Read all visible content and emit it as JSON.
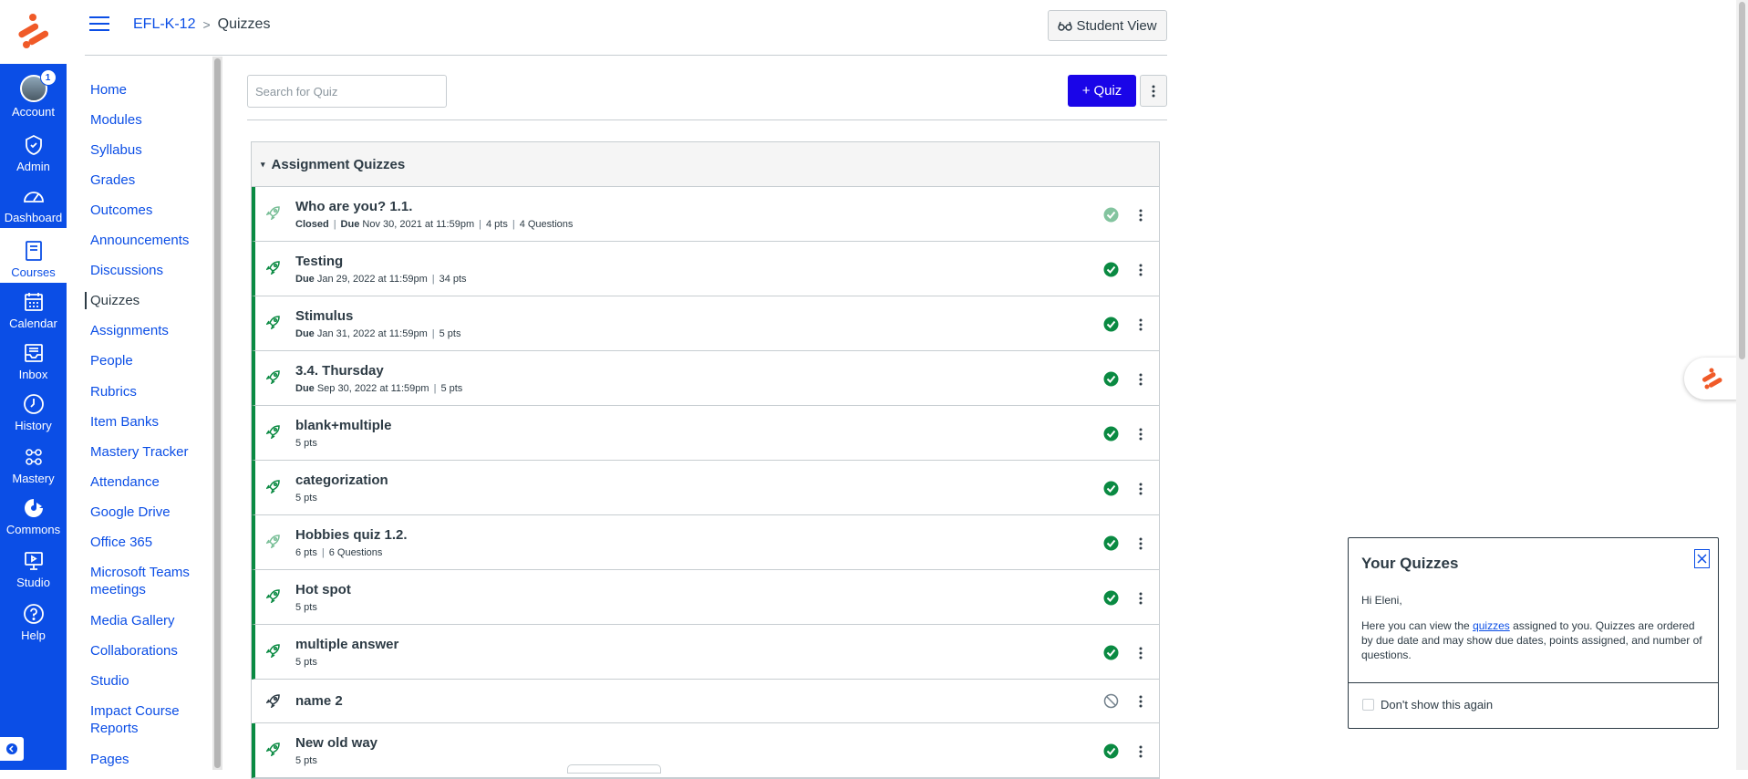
{
  "global_nav": {
    "items": [
      {
        "label": "Account",
        "icon": "avatar",
        "badge": "1"
      },
      {
        "label": "Admin",
        "icon": "shield-icon"
      },
      {
        "label": "Dashboard",
        "icon": "dashboard-icon"
      },
      {
        "label": "Courses",
        "icon": "book-icon",
        "active": true
      },
      {
        "label": "Calendar",
        "icon": "calendar-icon"
      },
      {
        "label": "Inbox",
        "icon": "inbox-icon"
      },
      {
        "label": "History",
        "icon": "clock-icon"
      },
      {
        "label": "Mastery",
        "icon": "mastery-icon"
      },
      {
        "label": "Commons",
        "icon": "commons-icon"
      },
      {
        "label": "Studio",
        "icon": "studio-icon"
      },
      {
        "label": "Help",
        "icon": "help-icon"
      }
    ]
  },
  "header": {
    "course": "EFL-K-12",
    "separator": ">",
    "page": "Quizzes",
    "student_view": "Student View"
  },
  "course_nav": [
    "Home",
    "Modules",
    "Syllabus",
    "Grades",
    "Outcomes",
    "Announcements",
    "Discussions",
    "Quizzes",
    "Assignments",
    "People",
    "Rubrics",
    "Item Banks",
    "Mastery Tracker",
    "Attendance",
    "Google Drive",
    "Office 365",
    "Microsoft Teams meetings",
    "Media Gallery",
    "Collaborations",
    "Studio",
    "Impact Course Reports",
    "Pages"
  ],
  "toolbar": {
    "search_placeholder": "Search for Quiz",
    "add_quiz_label": "Quiz",
    "add_quiz_plus": "+"
  },
  "quiz_group": {
    "title": "Assignment Quizzes",
    "caret": "▾",
    "quizzes": [
      {
        "title": "Who are you? 1.1.",
        "closed": "Closed",
        "due_label": "Due",
        "due": "Nov 30, 2021 at 11:59pm",
        "pts": "4 pts",
        "questions": "4 Questions",
        "published": true,
        "status": "published-faded"
      },
      {
        "title": "Testing",
        "due_label": "Due",
        "due": "Jan 29, 2022 at 11:59pm",
        "pts": "34 pts",
        "published": true,
        "status": "published"
      },
      {
        "title": "Stimulus",
        "due_label": "Due",
        "due": "Jan 31, 2022 at 11:59pm",
        "pts": "5 pts",
        "published": true,
        "status": "published"
      },
      {
        "title": "3.4. Thursday",
        "due_label": "Due",
        "due": "Sep 30, 2022 at 11:59pm",
        "pts": "5 pts",
        "published": true,
        "status": "published"
      },
      {
        "title": "blank+multiple",
        "pts": "5 pts",
        "published": true,
        "status": "published"
      },
      {
        "title": "categorization",
        "pts": "5 pts",
        "published": true,
        "status": "published"
      },
      {
        "title": "Hobbies quiz 1.2.",
        "pts": "6 pts",
        "questions": "6 Questions",
        "published": true,
        "status": "published",
        "faded_rocket": true
      },
      {
        "title": "Hot spot",
        "pts": "5 pts",
        "published": true,
        "status": "published"
      },
      {
        "title": "multiple answer",
        "pts": "5 pts",
        "published": true,
        "status": "published"
      },
      {
        "title": "name 2",
        "published": false,
        "status": "unpublished"
      },
      {
        "title": "New old way",
        "pts": "5 pts",
        "published": true,
        "status": "published"
      }
    ]
  },
  "tray": {
    "title": "Your Quizzes",
    "greeting": "Hi Eleni,",
    "body_before": "Here you can view the ",
    "body_link": "quizzes",
    "body_after": " assigned to you. Quizzes are ordered by due date and may show due dates, points assigned, and number of questions.",
    "checkbox_label": "Don't show this again"
  },
  "colors": {
    "brand_nav": "#0b4ee6",
    "primary_button": "#1a05e8",
    "published_green": "#0a8a42",
    "logo_orange": "#f05a28"
  }
}
